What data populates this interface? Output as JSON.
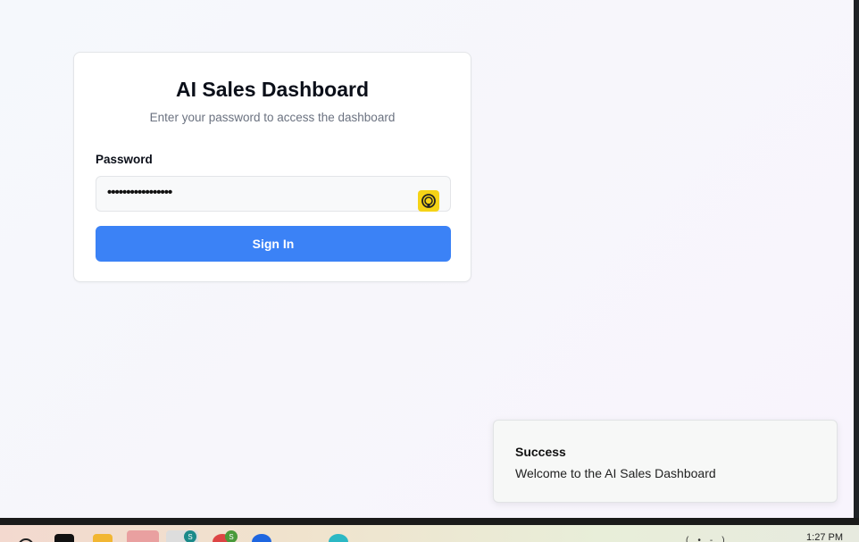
{
  "login": {
    "title": "AI Sales Dashboard",
    "subtitle": "Enter your password to access the dashboard",
    "password_label": "Password",
    "password_value": "•••••••••••••••••",
    "signin_label": "Sign In"
  },
  "toast": {
    "title": "Success",
    "description": "Welcome to the AI Sales Dashboard"
  },
  "taskbar": {
    "clock": "1:27 PM",
    "badges": [
      "S",
      "S"
    ]
  },
  "colors": {
    "primary": "#3b82f6",
    "password_manager_icon": "#f5d316"
  },
  "icons": [
    "password-manager-icon",
    "copilot-icon",
    "terminal-icon",
    "file-explorer-icon",
    "store-icon",
    "chrome-icon",
    "edge-icon"
  ]
}
